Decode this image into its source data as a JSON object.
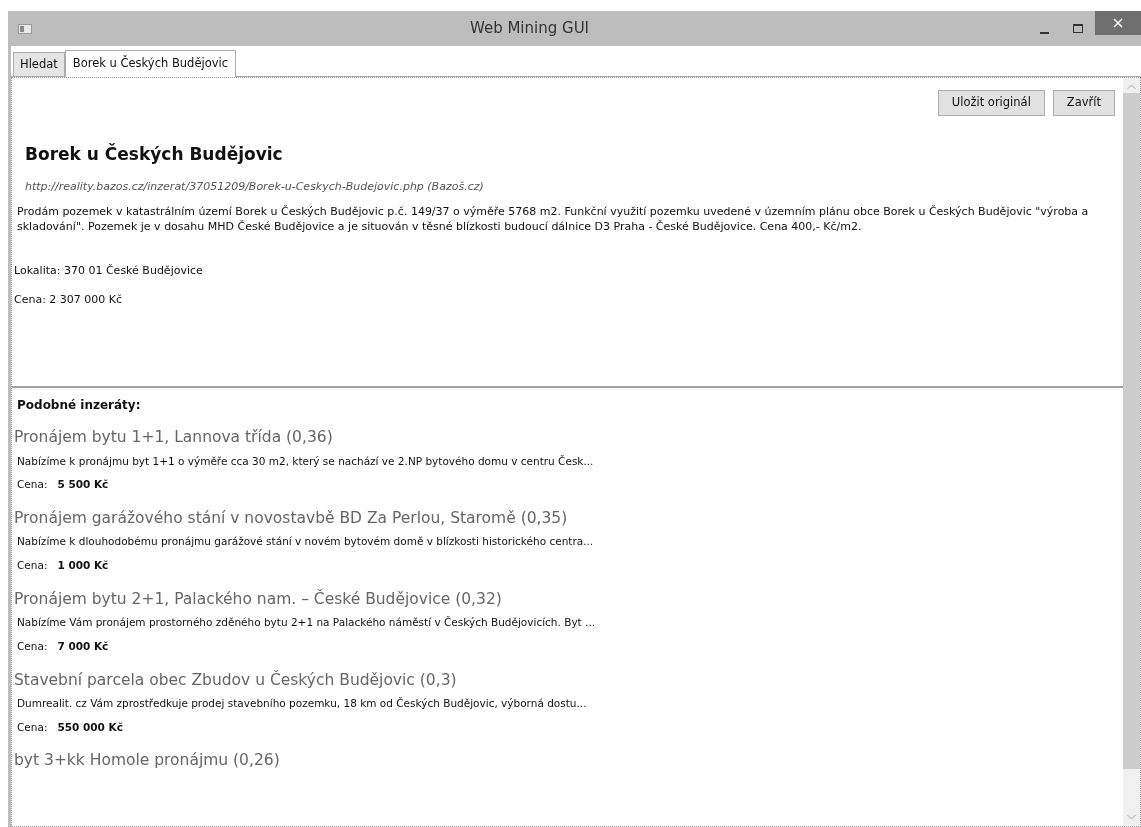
{
  "window": {
    "title": "Web Mining GUI"
  },
  "tabs": [
    {
      "label": "Hledat",
      "selected": false
    },
    {
      "label": "Borek u Českých Budějovic",
      "selected": true
    }
  ],
  "toolbar": {
    "buttons": [
      "Uložit originál",
      "Zavřít"
    ]
  },
  "detail": {
    "title": "Borek u Českých Budějovic",
    "url": "http://reality.bazos.cz/inzerat/37051209/Borek-u-Ceskych-Budejovic.php (Bazoš.cz)",
    "description": "Prodám pozemek v katastrálním území Borek u Českých Budějovic p.č. 149/37 o výměře 5768 m2. Funkční využití pozemku uvedené v územním plánu obce Borek u Českých Budějovic \"výroba a skladování\". Pozemek je v dosahu MHD České Budějovice a je situován v těsné blízkosti budoucí dálnice D3 Praha - České Budějovice. Cena 400,- Kč/m2.",
    "location": "Lokalita: 370 01 České Budějovice",
    "price": "Cena: 2 307 000 Kč"
  },
  "similar": {
    "heading": "Podobné inzeráty:",
    "items": [
      {
        "title": "Pronájem bytu 1+1, Lannova třída (0,36)",
        "description": "Nabízíme k pronájmu byt 1+1 o výměře cca 30 m2, který se nachází ve 2.NP bytového domu v centru Česk...",
        "price_label": "Cena:",
        "price": "5 500 Kč"
      },
      {
        "title": "Pronájem garážového stání v novostavbě BD Za Perlou, Staromě (0,35)",
        "description": "Nabízíme k dlouhodobému pronájmu garážové stání v novém bytovém domě v blízkosti historického centra...",
        "price_label": "Cena:",
        "price": "1 000 Kč"
      },
      {
        "title": "Pronájem bytu 2+1, Palackého nam. – České Budějovice (0,32)",
        "description": "Nabízíme Vám pronájem prostorného zděného bytu 2+1 na Palackého náměstí v Českých Budějovicích. Byt ...",
        "price_label": "Cena:",
        "price": "7 000 Kč"
      },
      {
        "title": "Stavební parcela obec Zbudov u Českých Budějovic (0,3)",
        "description": "Dumrealit. cz Vám zprostředkuje prodej stavebního pozemku, 18 km od Českých Budějovic, výborná dostu...",
        "price_label": "Cena:",
        "price": "550 000 Kč"
      },
      {
        "title": "byt 3+kk Homole pronájmu (0,26)"
      }
    ]
  }
}
